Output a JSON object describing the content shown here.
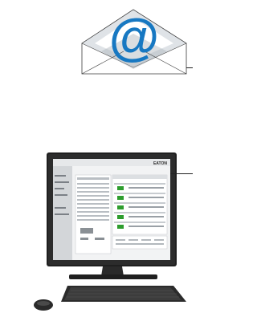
{
  "email_icon": {
    "symbol": "@",
    "icon": "at-sign-envelope-icon",
    "colors": {
      "at": "#1778c2",
      "envelope_fill": "#ffffff",
      "envelope_fold": "#cfd3d7"
    }
  },
  "monitor": {
    "icon": "desktop-computer-icon",
    "screen_brand": "EATON",
    "colors": {
      "bezel": "#1c1c1c",
      "screen_bg": "#f4f5f6",
      "accent_green": "#2e9d2e"
    }
  },
  "peripherals": [
    "keyboard",
    "mouse"
  ]
}
